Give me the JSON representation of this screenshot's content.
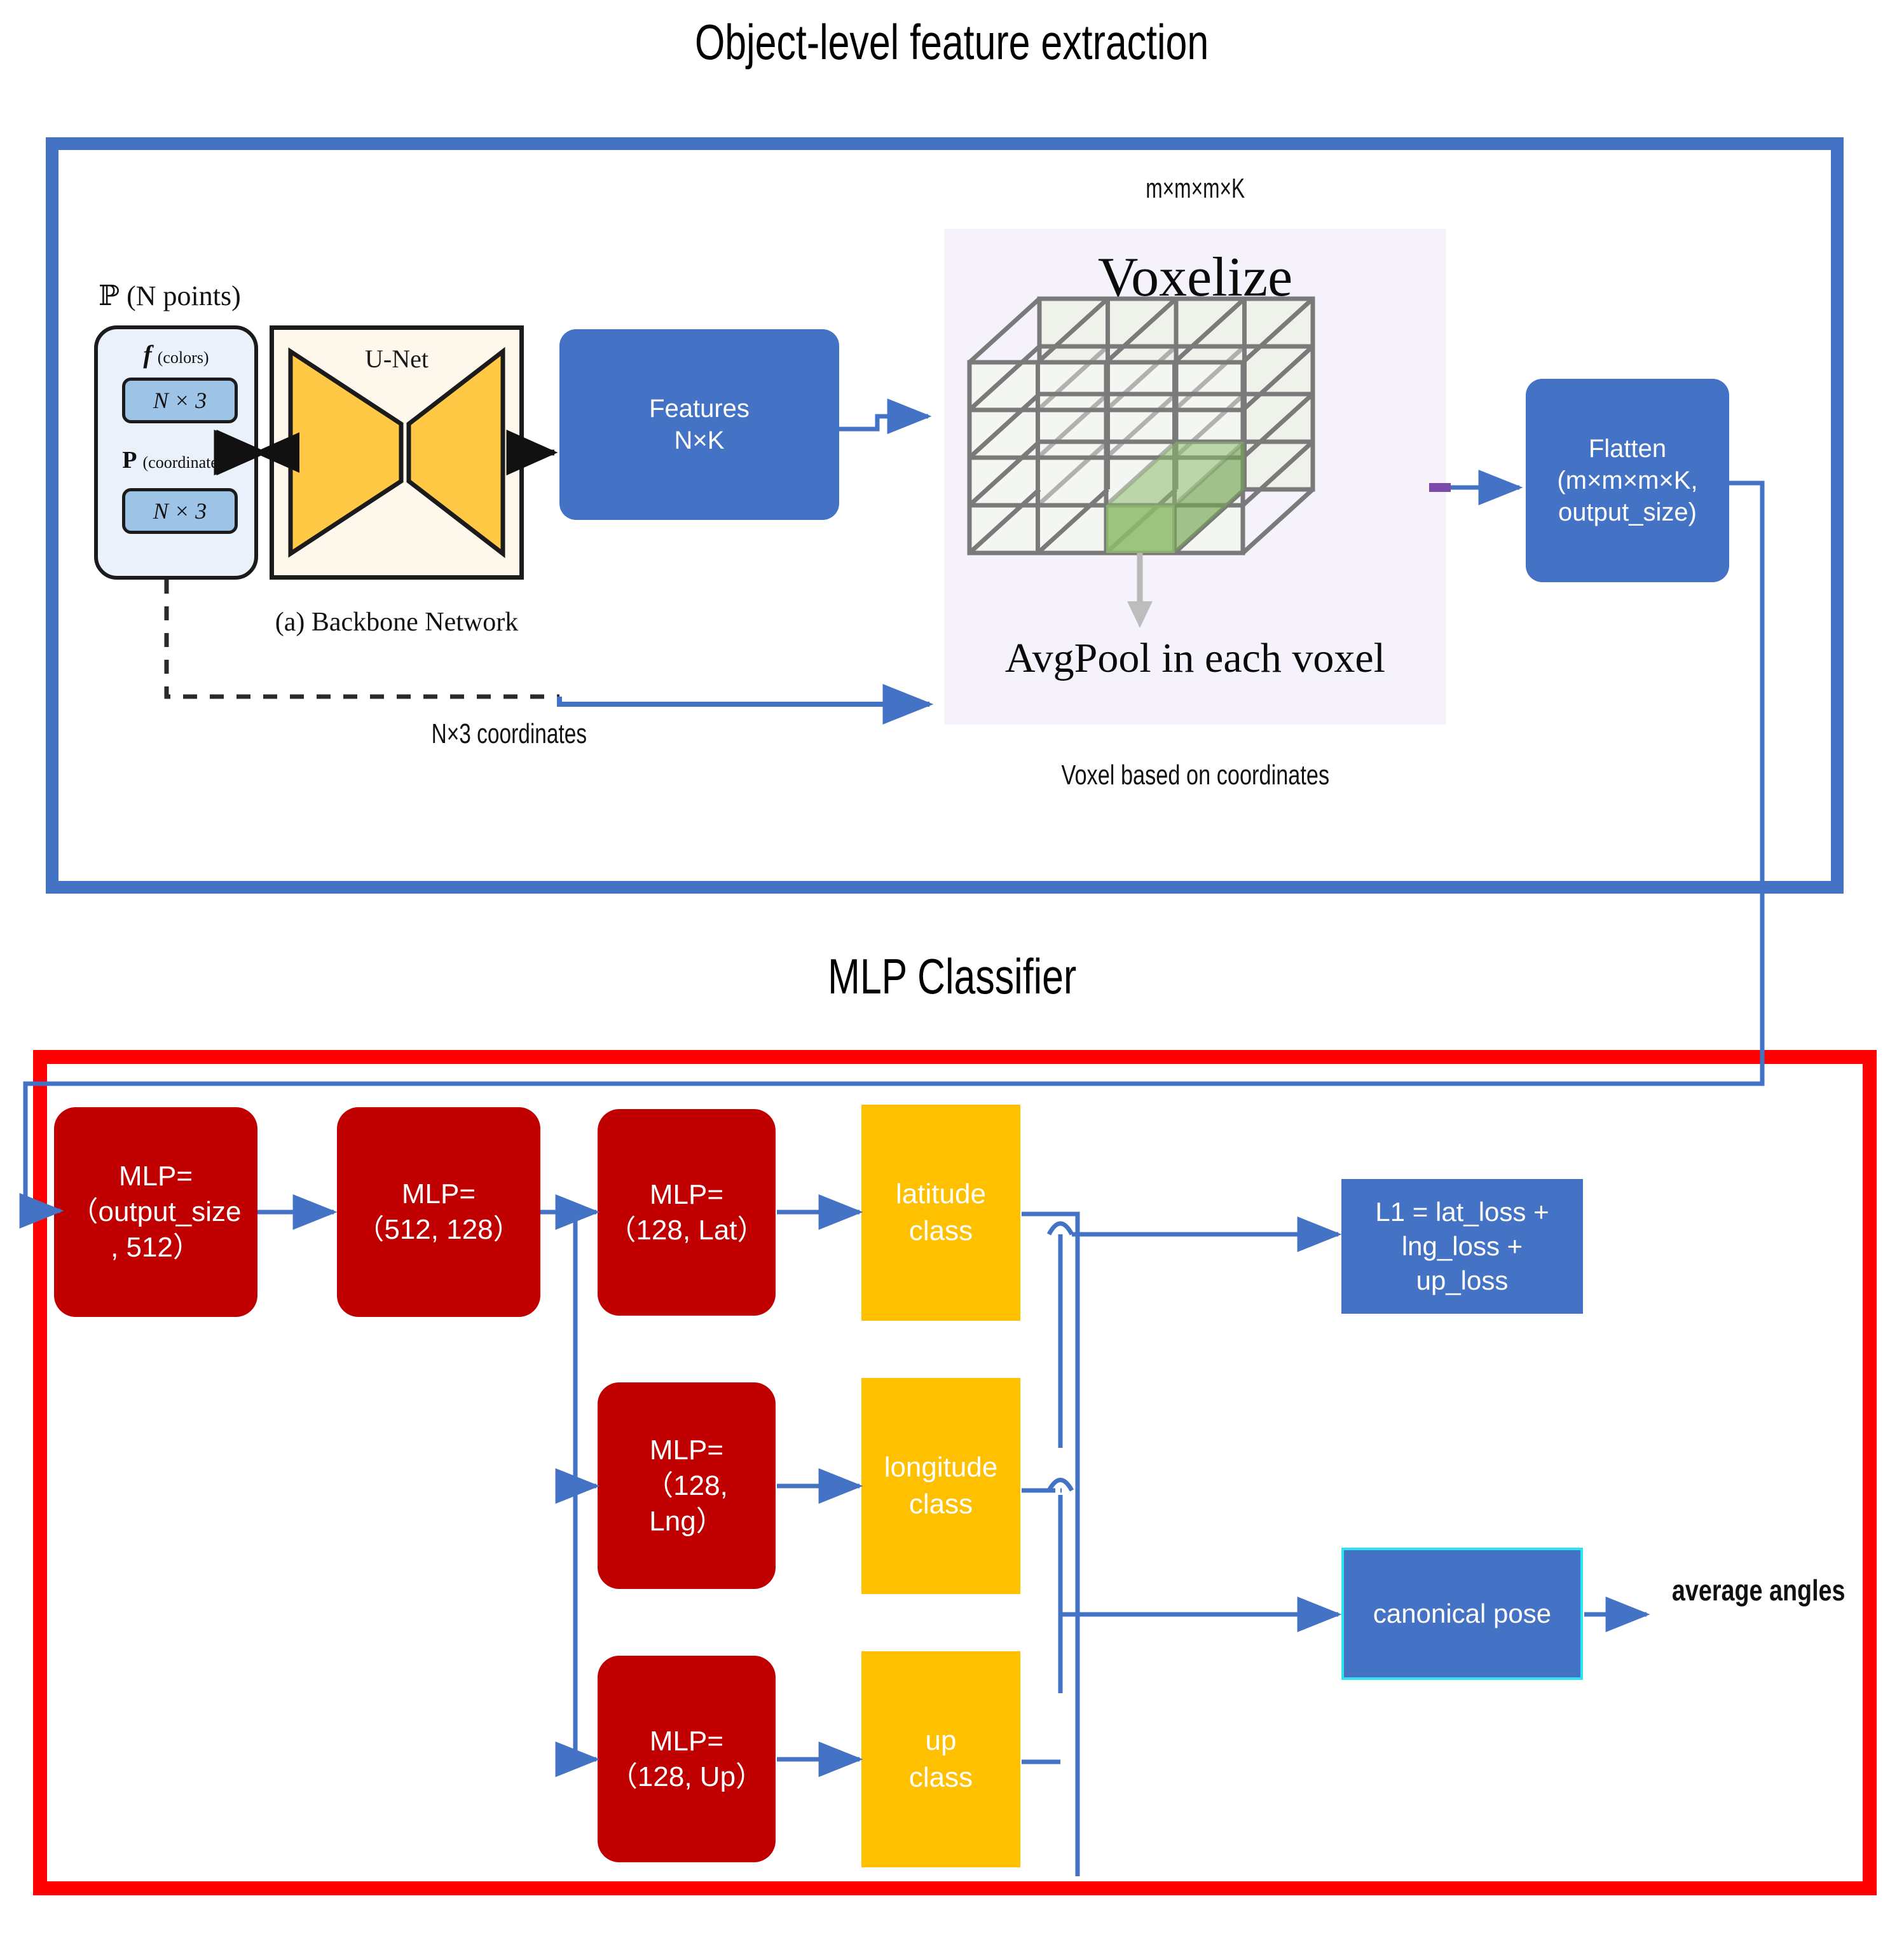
{
  "titles": {
    "top": "Object-level feature extraction",
    "mlp": "MLP Classifier"
  },
  "backbone": {
    "point_cloud_label": "ℙ (N points)",
    "feature_label": "f",
    "feature_label_sub": "(colors)",
    "coord_label": "P",
    "coord_label_sub": "(coordinates)",
    "tensor_colors": "N × 3",
    "tensor_coords": "N × 3",
    "unet_label": "U-Net",
    "caption": "(a) Backbone Network",
    "features_box": "Features\nN×K"
  },
  "voxel": {
    "shape_label": "m×m×m×K",
    "voxelize_word": "Voxelize",
    "avgpool_word": "AvgPool in each voxel",
    "caption": "Voxel based on coordinates",
    "coords_caption": "N×3 coordinates",
    "flatten_box": "Flatten\n(m×m×m×K,\noutput_size)"
  },
  "mlp": {
    "stage1": "MLP=\n（output_size\n, 512）",
    "stage2": "MLP=\n（512, 128）",
    "head_lat": "MLP=\n（128, Lat）",
    "head_lng": "MLP=\n（128,\nLng）",
    "head_up": "MLP=\n（128, Up）",
    "class_lat": "latitude\nclass",
    "class_lng": "longitude\nclass",
    "class_up": "up\nclass",
    "loss_box": "L1 = lat_loss +\nlng_loss +\nup_loss",
    "canonical_box": "canonical pose",
    "output_label": "average angles"
  },
  "colors": {
    "frame_top_border": "#4472C4",
    "frame_mlp_border": "#FF0000",
    "blue_box": "#4472C4",
    "red_box": "#C00000",
    "yellow_box": "#FFC000",
    "connector": "#4472C4",
    "voxel_panel": "#F6F2FC",
    "unet_fill": "#FFC845",
    "tensor_fill": "#9DC3E6",
    "canonical_border": "#2FE3F0"
  }
}
